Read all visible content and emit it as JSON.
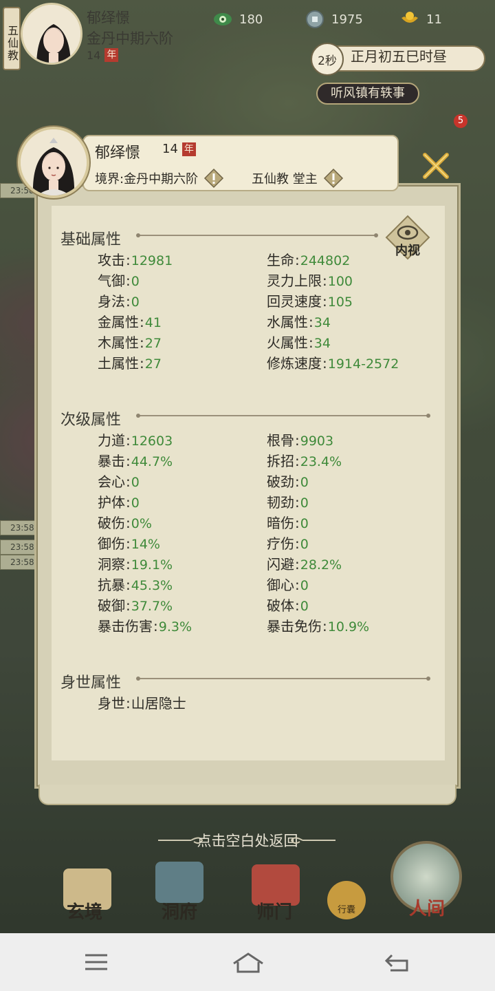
{
  "hud": {
    "sect_tag": "五仙教",
    "name": "郁绎憬",
    "realm": "金丹中期六阶",
    "age": "14",
    "age_unit": "年",
    "resources": [
      {
        "icon": "spirit-eye-icon",
        "value": "180"
      },
      {
        "icon": "coin-icon",
        "value": "1975"
      },
      {
        "icon": "gold-ingot-icon",
        "value": "11"
      }
    ],
    "time_seconds": "2秒",
    "time_text": "正月初五巳时昼",
    "rumor": "听风镇有轶事",
    "notice_count": "5",
    "side_times": [
      "23:58",
      "23:58",
      "23:58",
      "23:58"
    ]
  },
  "panel": {
    "name": "郁绎憬",
    "age": "14",
    "age_unit": "年",
    "realm_label": "境界:金丹中期六阶",
    "sect_label": "五仙教 堂主",
    "neishi": "内视",
    "sections": {
      "basic": {
        "title": "基础属性",
        "left": [
          {
            "label": "攻击",
            "value": "12981"
          },
          {
            "label": "气御",
            "value": "0"
          },
          {
            "label": "身法",
            "value": "0"
          },
          {
            "label": "金属性",
            "value": "41"
          },
          {
            "label": "木属性",
            "value": "27"
          },
          {
            "label": "土属性",
            "value": "27"
          }
        ],
        "right": [
          {
            "label": "生命",
            "value": "244802"
          },
          {
            "label": "灵力上限",
            "value": "100"
          },
          {
            "label": "回灵速度",
            "value": "105"
          },
          {
            "label": "水属性",
            "value": "34"
          },
          {
            "label": "火属性",
            "value": "34"
          },
          {
            "label": "修炼速度",
            "value": "1914-2572"
          }
        ]
      },
      "secondary": {
        "title": "次级属性",
        "left": [
          {
            "label": "力道",
            "value": "12603"
          },
          {
            "label": "暴击",
            "value": "44.7%"
          },
          {
            "label": "会心",
            "value": "0"
          },
          {
            "label": "护体",
            "value": "0"
          },
          {
            "label": "破伤",
            "value": "0%"
          },
          {
            "label": "御伤",
            "value": "14%"
          },
          {
            "label": "洞察",
            "value": "19.1%"
          },
          {
            "label": "抗暴",
            "value": "45.3%"
          },
          {
            "label": "破御",
            "value": "37.7%"
          },
          {
            "label": "暴击伤害",
            "value": "9.3%"
          }
        ],
        "right": [
          {
            "label": "根骨",
            "value": "9903"
          },
          {
            "label": "拆招",
            "value": "23.4%"
          },
          {
            "label": "破劲",
            "value": "0"
          },
          {
            "label": "韧劲",
            "value": "0"
          },
          {
            "label": "暗伤",
            "value": "0"
          },
          {
            "label": "疗伤",
            "value": "0"
          },
          {
            "label": "闪避",
            "value": "28.2%"
          },
          {
            "label": "御心",
            "value": "0"
          },
          {
            "label": "破体",
            "value": "0"
          },
          {
            "label": "暴击免伤",
            "value": "10.9%"
          }
        ]
      },
      "background": {
        "title": "身世属性",
        "items": [
          {
            "label": "身世",
            "value": "山居隐士"
          }
        ]
      }
    }
  },
  "tap_hint": "点击空白处返回",
  "bottom_nav": {
    "items": [
      "玄境",
      "洞府",
      "师门",
      "人间"
    ],
    "bag_label": "行囊"
  },
  "colors": {
    "value_green": "#3f8a3a",
    "panel_bg": "#e8e3cc",
    "badge_red": "#b53b2f"
  }
}
